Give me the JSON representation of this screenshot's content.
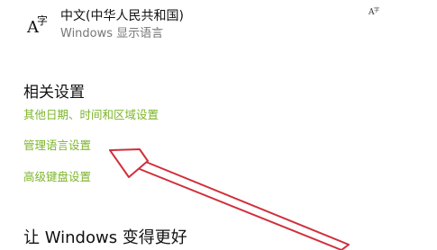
{
  "language_item": {
    "icon": "language-icon",
    "icon_glyph_latin": "A",
    "icon_glyph_cjk": "字",
    "name": "中文(中华人民共和国)",
    "subtitle": "Windows 显示语言",
    "feature_icon": "language-feature-icon"
  },
  "related_settings": {
    "heading": "相关设置",
    "links": [
      {
        "label": "其他日期、时间和区域设置"
      },
      {
        "label": "管理语言设置"
      },
      {
        "label": "高级键盘设置"
      }
    ]
  },
  "improve_section": {
    "heading": "让 Windows 变得更好"
  },
  "annotation": {
    "color": "#d0303a"
  },
  "colors": {
    "link": "#7db52a",
    "text": "#111111",
    "secondary_text": "#777777"
  }
}
